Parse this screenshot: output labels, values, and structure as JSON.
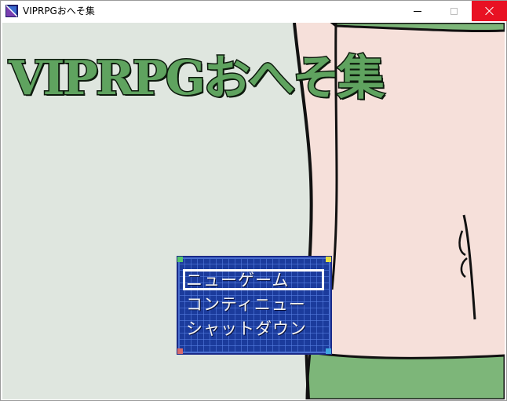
{
  "window": {
    "title": "VIPRPGおへそ集",
    "icon": "app-icon",
    "controls": [
      "minimize-icon",
      "maximize-icon",
      "close-icon"
    ],
    "close_hover_color": "#e81123"
  },
  "game": {
    "title": "VIPRPGおへそ集",
    "title_color": "#5fa35f",
    "background_colors": {
      "wall": "#dfe6df",
      "skin": "#f6e0da",
      "cloth": "#7db679"
    },
    "menu": {
      "items": [
        "ニューゲーム",
        "コンティニュー",
        "シャットダウン"
      ],
      "selected_index": 0,
      "window_color": "#1b3b9c"
    }
  }
}
